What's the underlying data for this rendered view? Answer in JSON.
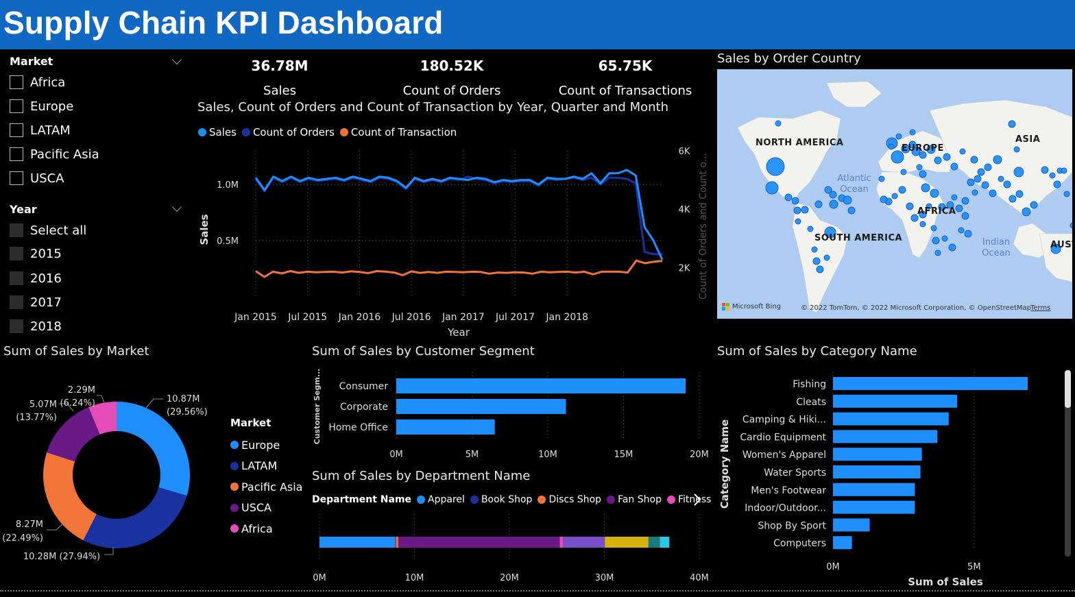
{
  "header": {
    "title": "Supply Chain KPI Dashboard"
  },
  "slicers": {
    "market": {
      "title": "Market",
      "options": [
        "Africa",
        "Europe",
        "LATAM",
        "Pacific Asia",
        "USCA"
      ]
    },
    "year": {
      "title": "Year",
      "options": [
        "Select all",
        "2015",
        "2016",
        "2017",
        "2018"
      ]
    }
  },
  "kpis": [
    {
      "value": "36.78M",
      "label": "Sales"
    },
    {
      "value": "180.52K",
      "label": "Count of Orders"
    },
    {
      "value": "65.75K",
      "label": "Count of Transactions"
    }
  ],
  "colors": {
    "sales": "#1f8fff",
    "orders": "#1a32a0",
    "transactions": "#f27438",
    "usca": "#6a1a86",
    "africa": "#e44db8",
    "bar": "#1f8fff"
  },
  "map": {
    "title": "Sales by Order Country",
    "region_labels": [
      "NORTH AMERICA",
      "EUROPE",
      "ASIA",
      "AFRICA",
      "SOUTH AMERICA",
      "AUST"
    ],
    "ocean_labels": [
      "Atlantic Ocean",
      "Indian Ocean"
    ],
    "bing_label": "Microsoft Bing",
    "copyright": "© 2022 TomTom, © 2022 Microsoft Corporation, © OpenStreetMap",
    "terms": "Terms"
  },
  "chart_data": [
    {
      "type": "line",
      "title": "Sales, Count of Orders and Count of Transaction by Year, Quarter and Month",
      "xlabel": "Year",
      "ylabel": "Sales",
      "y2label": "Count of Orders and Count o...",
      "x_ticks": [
        "Jan 2015",
        "Jul 2015",
        "Jan 2016",
        "Jul 2016",
        "Jan 2017",
        "Jul 2017",
        "Jan 2018"
      ],
      "y_ticks": [
        "0.5M",
        "1.0M"
      ],
      "y2_ticks": [
        "2K",
        "4K",
        "6K"
      ],
      "ylim": [
        0,
        1300000
      ],
      "y2lim": [
        1000,
        6000
      ],
      "series": [
        {
          "name": "Sales",
          "axis": "left",
          "values": [
            1060000,
            950000,
            1070000,
            1030000,
            1070000,
            1030000,
            1060000,
            1040000,
            1050000,
            1060000,
            1040000,
            1070000,
            1050000,
            1030000,
            1070000,
            1060000,
            1030000,
            970000,
            1060000,
            1030000,
            1050000,
            1030000,
            1060000,
            1050000,
            1040000,
            1060000,
            1050000,
            1020000,
            1040000,
            1030000,
            1040000,
            1040000,
            1000000,
            1060000,
            1050000,
            1050000,
            1070000,
            1050000,
            1100000,
            1010000,
            1100000,
            1100000,
            1130000,
            1080000,
            620000,
            500000,
            330000
          ]
        },
        {
          "name": "Count of Orders",
          "axis": "left",
          "values": [
            1050000,
            940000,
            1060000,
            1020000,
            1060000,
            1020000,
            1050000,
            1030000,
            1040000,
            1050000,
            1030000,
            1060000,
            1040000,
            1020000,
            1060000,
            1050000,
            1020000,
            960000,
            1050000,
            1020000,
            1040000,
            1020000,
            1050000,
            1040000,
            1070000,
            1050000,
            1040000,
            1010000,
            1030000,
            1020000,
            1030000,
            1030000,
            990000,
            1050000,
            1040000,
            1050000,
            1060000,
            1040000,
            1060000,
            1000000,
            1060000,
            1060000,
            1050000,
            1010000,
            400000,
            380000,
            380000
          ]
        },
        {
          "name": "Count of Transaction",
          "axis": "right",
          "values": [
            1880,
            1680,
            1860,
            1800,
            1880,
            1820,
            1860,
            1840,
            1850,
            1860,
            1830,
            1870,
            1850,
            1810,
            1880,
            1860,
            1830,
            1740,
            1870,
            1820,
            1850,
            1820,
            1860,
            1850,
            1840,
            1860,
            1850,
            1790,
            1830,
            1820,
            1840,
            1830,
            1790,
            1860,
            1840,
            1850,
            1860,
            1830,
            1860,
            1770,
            1860,
            1860,
            1860,
            1830,
            2240,
            2150,
            2200,
            2230
          ]
        }
      ]
    },
    {
      "type": "pie",
      "title": "Sum of Sales by Market",
      "legend_title": "Market",
      "slices": [
        {
          "name": "Europe",
          "value": 10.87,
          "label": "10.87M",
          "pct": "(29.56%)"
        },
        {
          "name": "LATAM",
          "value": 10.28,
          "label": "10.28M (27.94%)"
        },
        {
          "name": "Pacific Asia",
          "value": 8.27,
          "label": "8.27M",
          "pct": "(22.49%)"
        },
        {
          "name": "USCA",
          "value": 5.07,
          "label": "5.07M",
          "pct": "(13.77%)"
        },
        {
          "name": "Africa",
          "value": 2.29,
          "label": "2.29M",
          "pct": "(6.24%)"
        }
      ]
    },
    {
      "type": "bar",
      "title": "Sum of Sales by Customer Segment",
      "ylabel": "Customer Segm...",
      "categories": [
        "Consumer",
        "Corporate",
        "Home Office"
      ],
      "values": [
        19.1,
        11.2,
        6.5
      ],
      "x_ticks": [
        "0M",
        "5M",
        "10M",
        "15M",
        "20M"
      ],
      "xlim": [
        0,
        20
      ]
    },
    {
      "type": "bar",
      "title": "Sum of Sales by Department Name",
      "legend_title": "Department Name",
      "legend": [
        "Apparel",
        "Book Shop",
        "Discs Shop",
        "Fan Shop",
        "Fitness"
      ],
      "segments": [
        {
          "name": "Apparel",
          "value": 8.0,
          "color": "#1f8fff"
        },
        {
          "name": "Book Shop",
          "value": 0.05,
          "color": "#1a32a0"
        },
        {
          "name": "Discs Shop",
          "value": 0.25,
          "color": "#f27438"
        },
        {
          "name": "Fan Shop",
          "value": 17.0,
          "color": "#6a1a86"
        },
        {
          "name": "Fitness",
          "value": 0.35,
          "color": "#e44db8"
        },
        {
          "name": "",
          "value": 4.4,
          "color": "#7b4fc9"
        },
        {
          "name": "",
          "value": 4.6,
          "color": "#d6b40c"
        },
        {
          "name": "",
          "value": 1.2,
          "color": "#167c7c"
        },
        {
          "name": "",
          "value": 1.0,
          "color": "#29c8e6"
        }
      ],
      "x_ticks": [
        "0M",
        "10M",
        "20M",
        "30M",
        "40M"
      ],
      "xlim": [
        0,
        40
      ]
    },
    {
      "type": "bar",
      "title": "Sum of Sales by Category Name",
      "ylabel": "Category Name",
      "xlabel": "Sum of Sales",
      "categories": [
        "Fishing",
        "Cleats",
        "Camping & Hiki...",
        "Cardio Equipment",
        "Women's Apparel",
        "Water Sports",
        "Men's Footwear",
        "Indoor/Outdoor...",
        "Shop By Sport",
        "Computers"
      ],
      "values": [
        6.9,
        4.4,
        4.1,
        3.7,
        3.15,
        3.1,
        2.9,
        2.9,
        1.3,
        0.67
      ],
      "x_ticks": [
        "0M",
        "5M"
      ],
      "xlim": [
        0,
        6.9
      ]
    }
  ]
}
